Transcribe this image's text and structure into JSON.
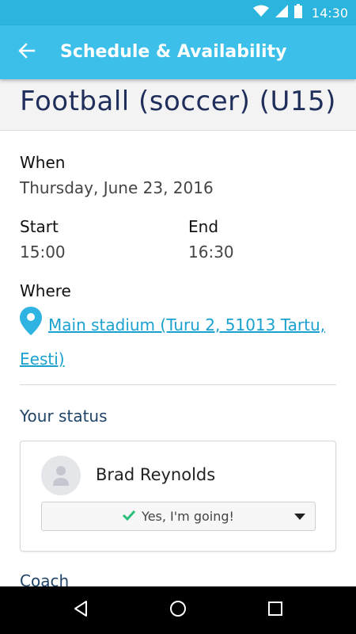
{
  "status_bar": {
    "time": "14:30"
  },
  "app_bar": {
    "title": "Schedule & Availability"
  },
  "event": {
    "title": "Football (soccer) (U15)"
  },
  "details": {
    "when_label": "When",
    "date": "Thursday, June 23, 2016",
    "start_label": "Start",
    "start_time": "15:00",
    "end_label": "End",
    "end_time": "16:30",
    "where_label": "Where",
    "location": "Main stadium (Turu 2, 51013 Tartu, Eesti)"
  },
  "your_status": {
    "section_title": "Your status",
    "member_name": "Brad Reynolds",
    "selected_option": "Yes, I'm going!"
  },
  "coach": {
    "section_title": "Coach"
  },
  "colors": {
    "accent": "#3cbfe8",
    "status_bar": "#2ab4de",
    "link": "#1aa1cf",
    "check": "#2bbf7a",
    "title": "#1f2e5a"
  },
  "icons": [
    "back-arrow-icon",
    "wifi-icon",
    "signal-icon",
    "battery-icon",
    "location-pin-icon",
    "user-avatar-icon",
    "check-icon",
    "dropdown-caret-icon",
    "nav-back-icon",
    "nav-home-icon",
    "nav-recents-icon"
  ]
}
